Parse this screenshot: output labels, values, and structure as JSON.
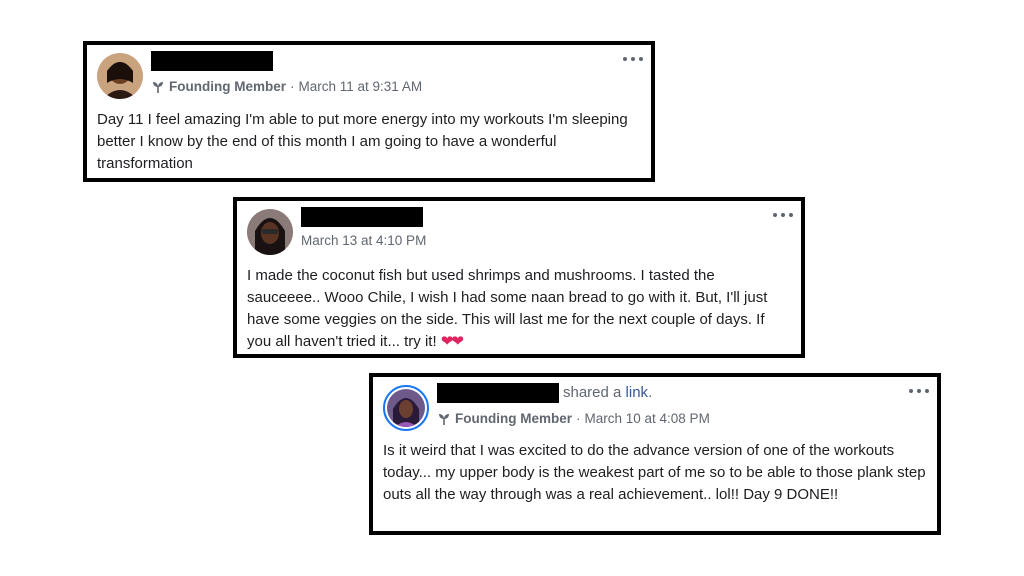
{
  "posts": [
    {
      "member_badge": "Founding Member",
      "meta_separator": "·",
      "timestamp": "March 11 at 9:31 AM",
      "text": "Day 11 I feel amazing I'm able to put more energy into my workouts I'm sleeping better I know by the end of this month I am going to have a wonderful transformation",
      "icons": [
        "avatar",
        "founding-member-icon",
        "more-options-icon"
      ]
    },
    {
      "timestamp": "March 13 at 4:10 PM",
      "text": "I made the coconut fish but used shrimps and mushrooms. I tasted the sauceeee.. Wooo Chile, I wish I had some naan bread to go with it. But, I'll just have some veggies on the side. This will last me for the next couple of days. If you all haven't tried it... try it!",
      "emoji": "❤❤",
      "icons": [
        "avatar",
        "more-options-icon"
      ]
    },
    {
      "shared_prefix": "shared a",
      "shared_link": "link",
      "shared_suffix": ".",
      "member_badge": "Founding Member",
      "meta_separator": "·",
      "timestamp": "March 10 at 4:08 PM",
      "text": "Is it weird that I was excited to do the advance version of one of the workouts today... my upper body is the weakest part of me so to be able to those plank step outs all the way through was a real achievement.. lol!! Day 9 DONE!!",
      "icons": [
        "avatar",
        "founding-member-icon",
        "more-options-icon"
      ]
    }
  ],
  "colors": {
    "card_border": "#000000",
    "meta_text": "#606770",
    "link": "#365899",
    "heart": "#e0245e",
    "avatar_ring": "#1877f2"
  }
}
